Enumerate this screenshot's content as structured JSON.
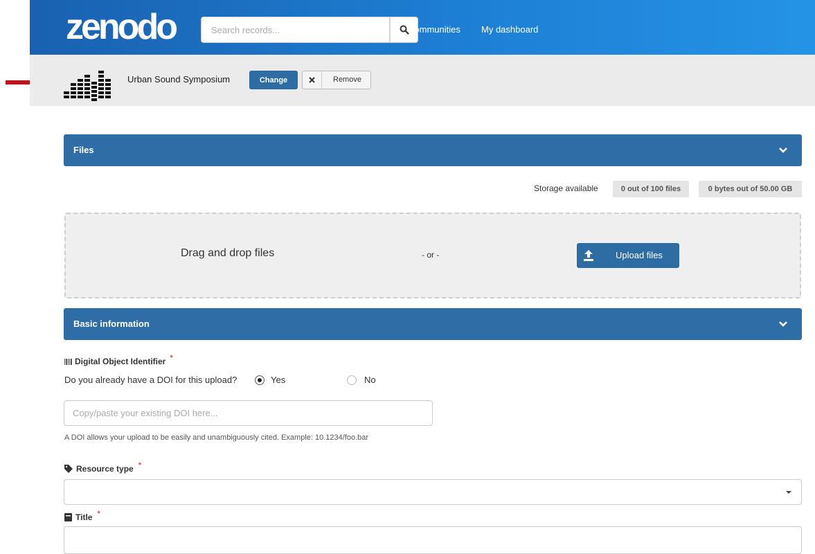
{
  "header": {
    "logo_text": "zenodo",
    "search": {
      "placeholder": "Search records...",
      "value": ""
    },
    "nav": {
      "communities": "Communities",
      "dashboard": "My dashboard"
    }
  },
  "community": {
    "name": "Urban Sound Symposium",
    "change_label": "Change",
    "remove_label": "Remove"
  },
  "files": {
    "title": "Files",
    "storage_label": "Storage available",
    "files_badge": "0 out of 100 files",
    "bytes_badge": "0 bytes out of 50.00 GB",
    "drag_text": "Drag and drop files",
    "or_text": "- or -",
    "upload_label": "Upload files"
  },
  "basic": {
    "title": "Basic information",
    "doi_heading": "Digital Object Identifier",
    "doi_question": "Do you already have a DOI for this upload?",
    "yes_label": "Yes",
    "no_label": "No",
    "doi_selected": "Yes",
    "doi_placeholder": "Copy/paste your existing DOI here...",
    "doi_help": "A DOI allows your upload to be easily and unambiguously cited. Example: 10.1234/foo.bar",
    "resource_heading": "Resource type",
    "title_heading": "Title",
    "required_mark": "*"
  },
  "colors": {
    "nav_gradient_start": "#1a61b0",
    "nav_gradient_end": "#2493e6",
    "panel_header": "#2f6da7",
    "primary_button": "#2e6da4",
    "annotation_arrow": "#c0141b",
    "required": "#d9534f"
  },
  "icons": {
    "search": "search-icon",
    "remove": "close-icon",
    "chevron": "chevron-down-icon",
    "upload": "upload-icon",
    "barcode": "barcode-icon",
    "tag": "tag-icon",
    "book": "book-icon"
  }
}
